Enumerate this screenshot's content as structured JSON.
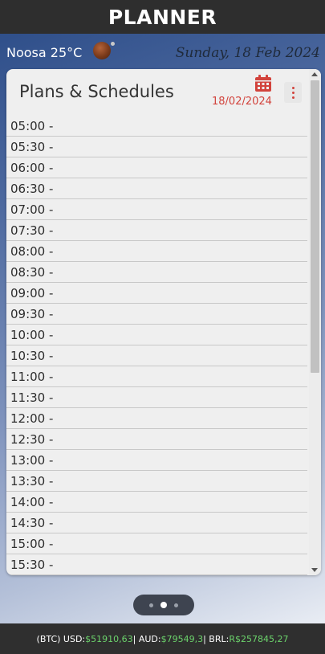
{
  "header": {
    "title": "PLANNER"
  },
  "weather": {
    "text": "Noosa 25°C",
    "icon": "weather-icon"
  },
  "date_header": "Sunday, 18 Feb 2024",
  "card": {
    "title": "Plans & Schedules",
    "date": "18/02/2024",
    "calendar_icon": "calendar-icon",
    "menu_icon": "more-vertical-icon",
    "accent_color": "#d2433c"
  },
  "slots": [
    "05:00 -",
    "05:30 -",
    "06:00 -",
    "06:30 -",
    "07:00 -",
    "07:30 -",
    "08:00 -",
    "08:30 -",
    "09:00 -",
    "09:30 -",
    "10:00 -",
    "10:30 -",
    "11:00 -",
    "11:30 -",
    "12:00 -",
    "12:30 -",
    "13:00 -",
    "13:30 -",
    "14:00 -",
    "14:30 -",
    "15:00 -",
    "15:30 -"
  ],
  "pager": {
    "pages": 3,
    "active_index": 1
  },
  "ticker": {
    "prefix": "(BTC) USD: ",
    "usd": "$51910,63",
    "sep1": " | AUD: ",
    "aud": "$79549,3",
    "sep2": " | BRL: ",
    "brl": "R$257845,27",
    "value_color": "#6cd46c"
  }
}
